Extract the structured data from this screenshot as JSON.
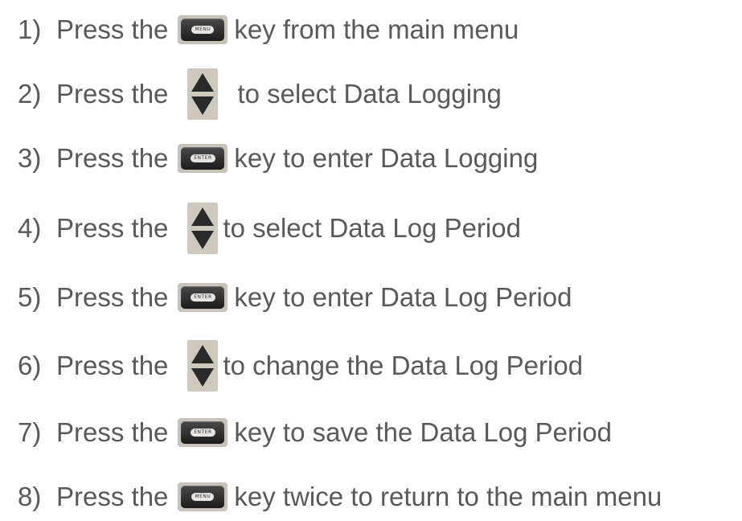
{
  "steps": [
    {
      "number": "1)",
      "before": "Press the",
      "key": "menu",
      "key_text": "MENU",
      "after": "key from the main menu"
    },
    {
      "number": "2)",
      "before": "Press the",
      "key": "arrows",
      "key_text": "",
      "after": "to select Data Logging"
    },
    {
      "number": "3)",
      "before": "Press the",
      "key": "enter",
      "key_text": "ENTER",
      "after": "key to enter Data Logging"
    },
    {
      "number": "4)",
      "before": "Press the",
      "key": "arrows",
      "key_text": "",
      "after": "to select Data Log Period"
    },
    {
      "number": "5)",
      "before": "Press the",
      "key": "enter",
      "key_text": "ENTER",
      "after": "key to enter Data Log Period"
    },
    {
      "number": "6)",
      "before": "Press the",
      "key": "arrows",
      "key_text": "",
      "after": "to change the Data Log Period"
    },
    {
      "number": "7)",
      "before": "Press the",
      "key": "enter",
      "key_text": "ENTER",
      "after": "key to save the Data Log Period"
    },
    {
      "number": "8)",
      "before": "Press the",
      "key": "menu",
      "key_text": "MENU",
      "after": "key twice to return to the main menu"
    }
  ],
  "icons": {
    "menu": "menu-key-icon",
    "enter": "enter-key-icon",
    "arrows": "up-down-arrow-key-icon"
  },
  "colors": {
    "text": "#595959",
    "key_body": "#1c1c1c",
    "key_bezel": "#c9c2b8",
    "arrow_fill": "#2a2a2a"
  }
}
